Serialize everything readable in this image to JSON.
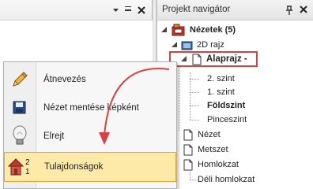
{
  "left_window": {
    "buttons": {
      "dropdown": "▾",
      "minimize": "−",
      "close": "✕"
    }
  },
  "panel": {
    "title": "Projekt navigátor",
    "pin_glyph": "⊥",
    "close_glyph": "✕"
  },
  "tree": {
    "root": "Nézetek (5)",
    "group_2d": "2D rajz",
    "floorplan": "Alaprajz -",
    "levels": [
      "2. szint",
      "1. szint",
      "Földszint",
      "Pinceszint"
    ],
    "items": [
      "Nézet",
      "Metszet",
      "Homlokzat"
    ],
    "sub_facade": "Déli homlokzat"
  },
  "context_menu": {
    "items": [
      {
        "label": "Átnevezés",
        "icon": "pencil-icon"
      },
      {
        "label": "Nézet mentése képként",
        "icon": "floppy-disk-icon"
      },
      {
        "label": "Elrejt",
        "icon": "light-bulb-icon"
      },
      {
        "label": "Tulajdonságok",
        "icon": "house-levels-icon",
        "highlighted": true
      }
    ],
    "properties_icon_numbers": [
      "2",
      "1"
    ]
  },
  "colors": {
    "highlight_fill": "#fde9a8",
    "highlight_border": "#e8a837",
    "annotation_red": "#d94040"
  }
}
